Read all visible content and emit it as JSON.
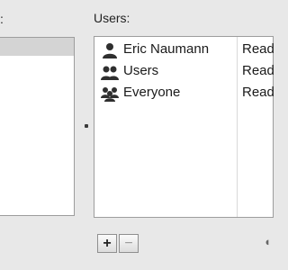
{
  "left_pane": {
    "label": ":"
  },
  "users_pane": {
    "label": "Users:",
    "rows": [
      {
        "name": "Eric Naumann",
        "permission": "Read",
        "icon": "person-icon"
      },
      {
        "name": "Users",
        "permission": "Read",
        "icon": "group-icon"
      },
      {
        "name": "Everyone",
        "permission": "Read",
        "icon": "everyone-icon"
      }
    ]
  },
  "buttons": {
    "add_label": "+",
    "remove_label": "−"
  },
  "colors": {
    "window_bg": "#e8e8e8",
    "panel_bg": "#ffffff",
    "selected_row_bg": "#d4d4d4",
    "border": "#9d9d9d"
  }
}
